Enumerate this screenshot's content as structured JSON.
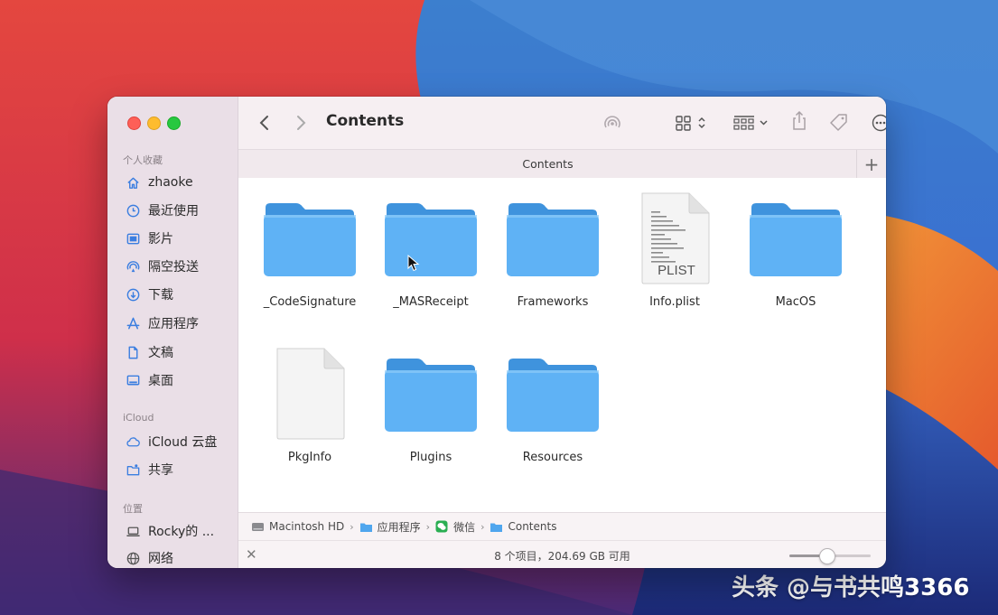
{
  "watermark": "头条 @与书共鸣3366",
  "window": {
    "title": "Contents",
    "tab_label": "Contents",
    "tab_add_label": "+"
  },
  "sidebar": {
    "sections": [
      {
        "label": "个人收藏"
      },
      {
        "label": "iCloud"
      },
      {
        "label": "位置"
      }
    ],
    "items": [
      {
        "label": "zhaoke",
        "icon": "home-icon"
      },
      {
        "label": "最近使用",
        "icon": "clock-icon"
      },
      {
        "label": "影片",
        "icon": "film-icon"
      },
      {
        "label": "隔空投送",
        "icon": "airdrop-icon"
      },
      {
        "label": "下载",
        "icon": "download-icon"
      },
      {
        "label": "应用程序",
        "icon": "applications-icon"
      },
      {
        "label": "文稿",
        "icon": "document-icon"
      },
      {
        "label": "桌面",
        "icon": "desktop-icon"
      },
      {
        "label": "iCloud 云盘",
        "icon": "cloud-icon"
      },
      {
        "label": "共享",
        "icon": "shared-folder-icon"
      },
      {
        "label": "Rocky的 ...",
        "icon": "laptop-icon"
      },
      {
        "label": "网络",
        "icon": "network-icon"
      }
    ]
  },
  "files": [
    {
      "name": "_CodeSignature",
      "kind": "folder"
    },
    {
      "name": "_MASReceipt",
      "kind": "folder"
    },
    {
      "name": "Frameworks",
      "kind": "folder"
    },
    {
      "name": "Info.plist",
      "kind": "plist",
      "badge": "PLIST"
    },
    {
      "name": "MacOS",
      "kind": "folder"
    },
    {
      "name": "PkgInfo",
      "kind": "document"
    },
    {
      "name": "Plugins",
      "kind": "folder"
    },
    {
      "name": "Resources",
      "kind": "folder"
    }
  ],
  "pathbar": [
    {
      "label": "Macintosh HD",
      "icon": "hard-drive-icon"
    },
    {
      "label": "应用程序",
      "icon": "folder-icon"
    },
    {
      "label": "微信",
      "icon": "wechat-icon"
    },
    {
      "label": "Contents",
      "icon": "folder-icon"
    }
  ],
  "pathbar_separator": "›",
  "status": {
    "text": "8 个项目，204.69 GB 可用",
    "close_glyph": "✕",
    "icon_size_level": 0.45
  },
  "colors": {
    "folder": "#5fb2f5",
    "folder_tab": "#3f93dd",
    "sidebar_bg": "#eadfe7",
    "accent": "#1e7bea"
  }
}
